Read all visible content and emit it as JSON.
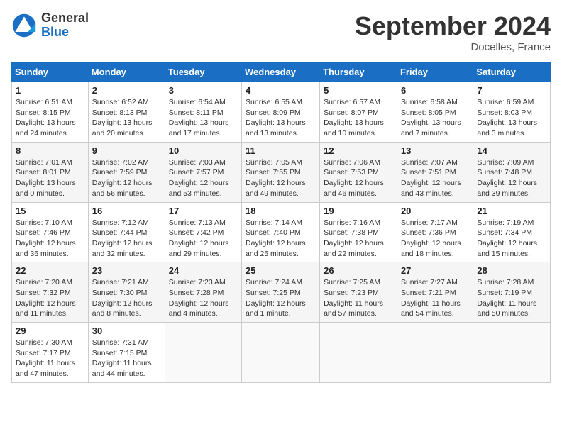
{
  "header": {
    "logo_text_general": "General",
    "logo_text_blue": "Blue",
    "month_title": "September 2024",
    "location": "Docelles, France"
  },
  "weekdays": [
    "Sunday",
    "Monday",
    "Tuesday",
    "Wednesday",
    "Thursday",
    "Friday",
    "Saturday"
  ],
  "weeks": [
    [
      {
        "day": "1",
        "info": "Sunrise: 6:51 AM\nSunset: 8:15 PM\nDaylight: 13 hours\nand 24 minutes."
      },
      {
        "day": "2",
        "info": "Sunrise: 6:52 AM\nSunset: 8:13 PM\nDaylight: 13 hours\nand 20 minutes."
      },
      {
        "day": "3",
        "info": "Sunrise: 6:54 AM\nSunset: 8:11 PM\nDaylight: 13 hours\nand 17 minutes."
      },
      {
        "day": "4",
        "info": "Sunrise: 6:55 AM\nSunset: 8:09 PM\nDaylight: 13 hours\nand 13 minutes."
      },
      {
        "day": "5",
        "info": "Sunrise: 6:57 AM\nSunset: 8:07 PM\nDaylight: 13 hours\nand 10 minutes."
      },
      {
        "day": "6",
        "info": "Sunrise: 6:58 AM\nSunset: 8:05 PM\nDaylight: 13 hours\nand 7 minutes."
      },
      {
        "day": "7",
        "info": "Sunrise: 6:59 AM\nSunset: 8:03 PM\nDaylight: 13 hours\nand 3 minutes."
      }
    ],
    [
      {
        "day": "8",
        "info": "Sunrise: 7:01 AM\nSunset: 8:01 PM\nDaylight: 13 hours\nand 0 minutes."
      },
      {
        "day": "9",
        "info": "Sunrise: 7:02 AM\nSunset: 7:59 PM\nDaylight: 12 hours\nand 56 minutes."
      },
      {
        "day": "10",
        "info": "Sunrise: 7:03 AM\nSunset: 7:57 PM\nDaylight: 12 hours\nand 53 minutes."
      },
      {
        "day": "11",
        "info": "Sunrise: 7:05 AM\nSunset: 7:55 PM\nDaylight: 12 hours\nand 49 minutes."
      },
      {
        "day": "12",
        "info": "Sunrise: 7:06 AM\nSunset: 7:53 PM\nDaylight: 12 hours\nand 46 minutes."
      },
      {
        "day": "13",
        "info": "Sunrise: 7:07 AM\nSunset: 7:51 PM\nDaylight: 12 hours\nand 43 minutes."
      },
      {
        "day": "14",
        "info": "Sunrise: 7:09 AM\nSunset: 7:48 PM\nDaylight: 12 hours\nand 39 minutes."
      }
    ],
    [
      {
        "day": "15",
        "info": "Sunrise: 7:10 AM\nSunset: 7:46 PM\nDaylight: 12 hours\nand 36 minutes."
      },
      {
        "day": "16",
        "info": "Sunrise: 7:12 AM\nSunset: 7:44 PM\nDaylight: 12 hours\nand 32 minutes."
      },
      {
        "day": "17",
        "info": "Sunrise: 7:13 AM\nSunset: 7:42 PM\nDaylight: 12 hours\nand 29 minutes."
      },
      {
        "day": "18",
        "info": "Sunrise: 7:14 AM\nSunset: 7:40 PM\nDaylight: 12 hours\nand 25 minutes."
      },
      {
        "day": "19",
        "info": "Sunrise: 7:16 AM\nSunset: 7:38 PM\nDaylight: 12 hours\nand 22 minutes."
      },
      {
        "day": "20",
        "info": "Sunrise: 7:17 AM\nSunset: 7:36 PM\nDaylight: 12 hours\nand 18 minutes."
      },
      {
        "day": "21",
        "info": "Sunrise: 7:19 AM\nSunset: 7:34 PM\nDaylight: 12 hours\nand 15 minutes."
      }
    ],
    [
      {
        "day": "22",
        "info": "Sunrise: 7:20 AM\nSunset: 7:32 PM\nDaylight: 12 hours\nand 11 minutes."
      },
      {
        "day": "23",
        "info": "Sunrise: 7:21 AM\nSunset: 7:30 PM\nDaylight: 12 hours\nand 8 minutes."
      },
      {
        "day": "24",
        "info": "Sunrise: 7:23 AM\nSunset: 7:28 PM\nDaylight: 12 hours\nand 4 minutes."
      },
      {
        "day": "25",
        "info": "Sunrise: 7:24 AM\nSunset: 7:25 PM\nDaylight: 12 hours\nand 1 minute."
      },
      {
        "day": "26",
        "info": "Sunrise: 7:25 AM\nSunset: 7:23 PM\nDaylight: 11 hours\nand 57 minutes."
      },
      {
        "day": "27",
        "info": "Sunrise: 7:27 AM\nSunset: 7:21 PM\nDaylight: 11 hours\nand 54 minutes."
      },
      {
        "day": "28",
        "info": "Sunrise: 7:28 AM\nSunset: 7:19 PM\nDaylight: 11 hours\nand 50 minutes."
      }
    ],
    [
      {
        "day": "29",
        "info": "Sunrise: 7:30 AM\nSunset: 7:17 PM\nDaylight: 11 hours\nand 47 minutes."
      },
      {
        "day": "30",
        "info": "Sunrise: 7:31 AM\nSunset: 7:15 PM\nDaylight: 11 hours\nand 44 minutes."
      },
      null,
      null,
      null,
      null,
      null
    ]
  ]
}
